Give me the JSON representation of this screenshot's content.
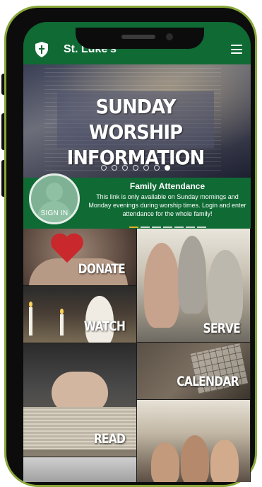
{
  "app": {
    "title": "St. Luke's",
    "logo_icon": "shield-cross-icon",
    "menu_icon": "hamburger-menu-icon",
    "brand_color": "#0f6a34"
  },
  "hero": {
    "title_line1": "SUNDAY WORSHIP",
    "title_line2": "INFORMATION",
    "slide_count": 7,
    "active_slide": 7
  },
  "attendance": {
    "title": "Family Attendance",
    "text": "This link is only available on Sunday mornings and Monday evenings during worship times.  Login and enter attendance for the whole family!",
    "signin_label": "SIGN IN",
    "page_count": 7,
    "active_page": 1
  },
  "tiles": {
    "donate": "DONATE",
    "serve": "SERVE",
    "watch": "WATCH",
    "calendar": "CALENDAR",
    "read": "READ"
  }
}
